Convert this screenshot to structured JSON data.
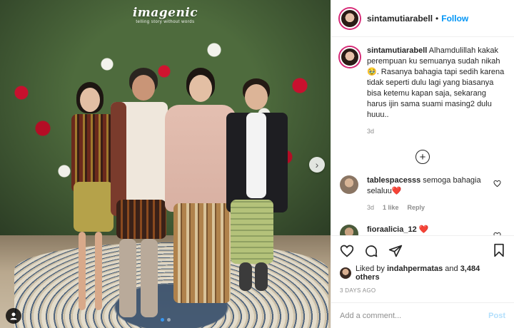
{
  "photo": {
    "brand": "imagenic",
    "brand_sub": "telling story without words",
    "carousel_dots": 2,
    "active_dot": 1
  },
  "header": {
    "username": "sintamutiarabell",
    "separator": "•",
    "follow_label": "Follow"
  },
  "caption": {
    "username": "sintamutiarabell",
    "text": " Alhamdulillah kakak perempuan ku semuanya sudah nikah 🥹. Rasanya bahagia tapi sedih karena tidak seperti dulu lagi yang biasanya bisa ketemu kapan saja, sekarang harus ijin sama suami masing2 dulu huuu..",
    "time": "3d"
  },
  "load_more_label": "+",
  "comments": [
    {
      "username": "tablespacesss",
      "text": " semoga bahagia selaluu",
      "emoji": "❤️",
      "time": "3d",
      "likes": "1 like",
      "reply": "Reply",
      "avatar_color": "#8a7563"
    },
    {
      "username": "fioraalicia_12",
      "text": " ",
      "emoji": "❤️",
      "avatar_color": "#4a5a3a"
    }
  ],
  "actions": {
    "liked_by_prefix": "Liked by ",
    "liked_by_user": "indahpermatas",
    "and_label": " and ",
    "others": "3,484 others",
    "date": "3 DAYS AGO"
  },
  "add_comment": {
    "placeholder": "Add a comment...",
    "post_label": "Post"
  },
  "colors": {
    "accent": "#0095f6",
    "heart": "#e0245e",
    "muted": "#8e8e8e",
    "story_ring": "#d62976"
  }
}
